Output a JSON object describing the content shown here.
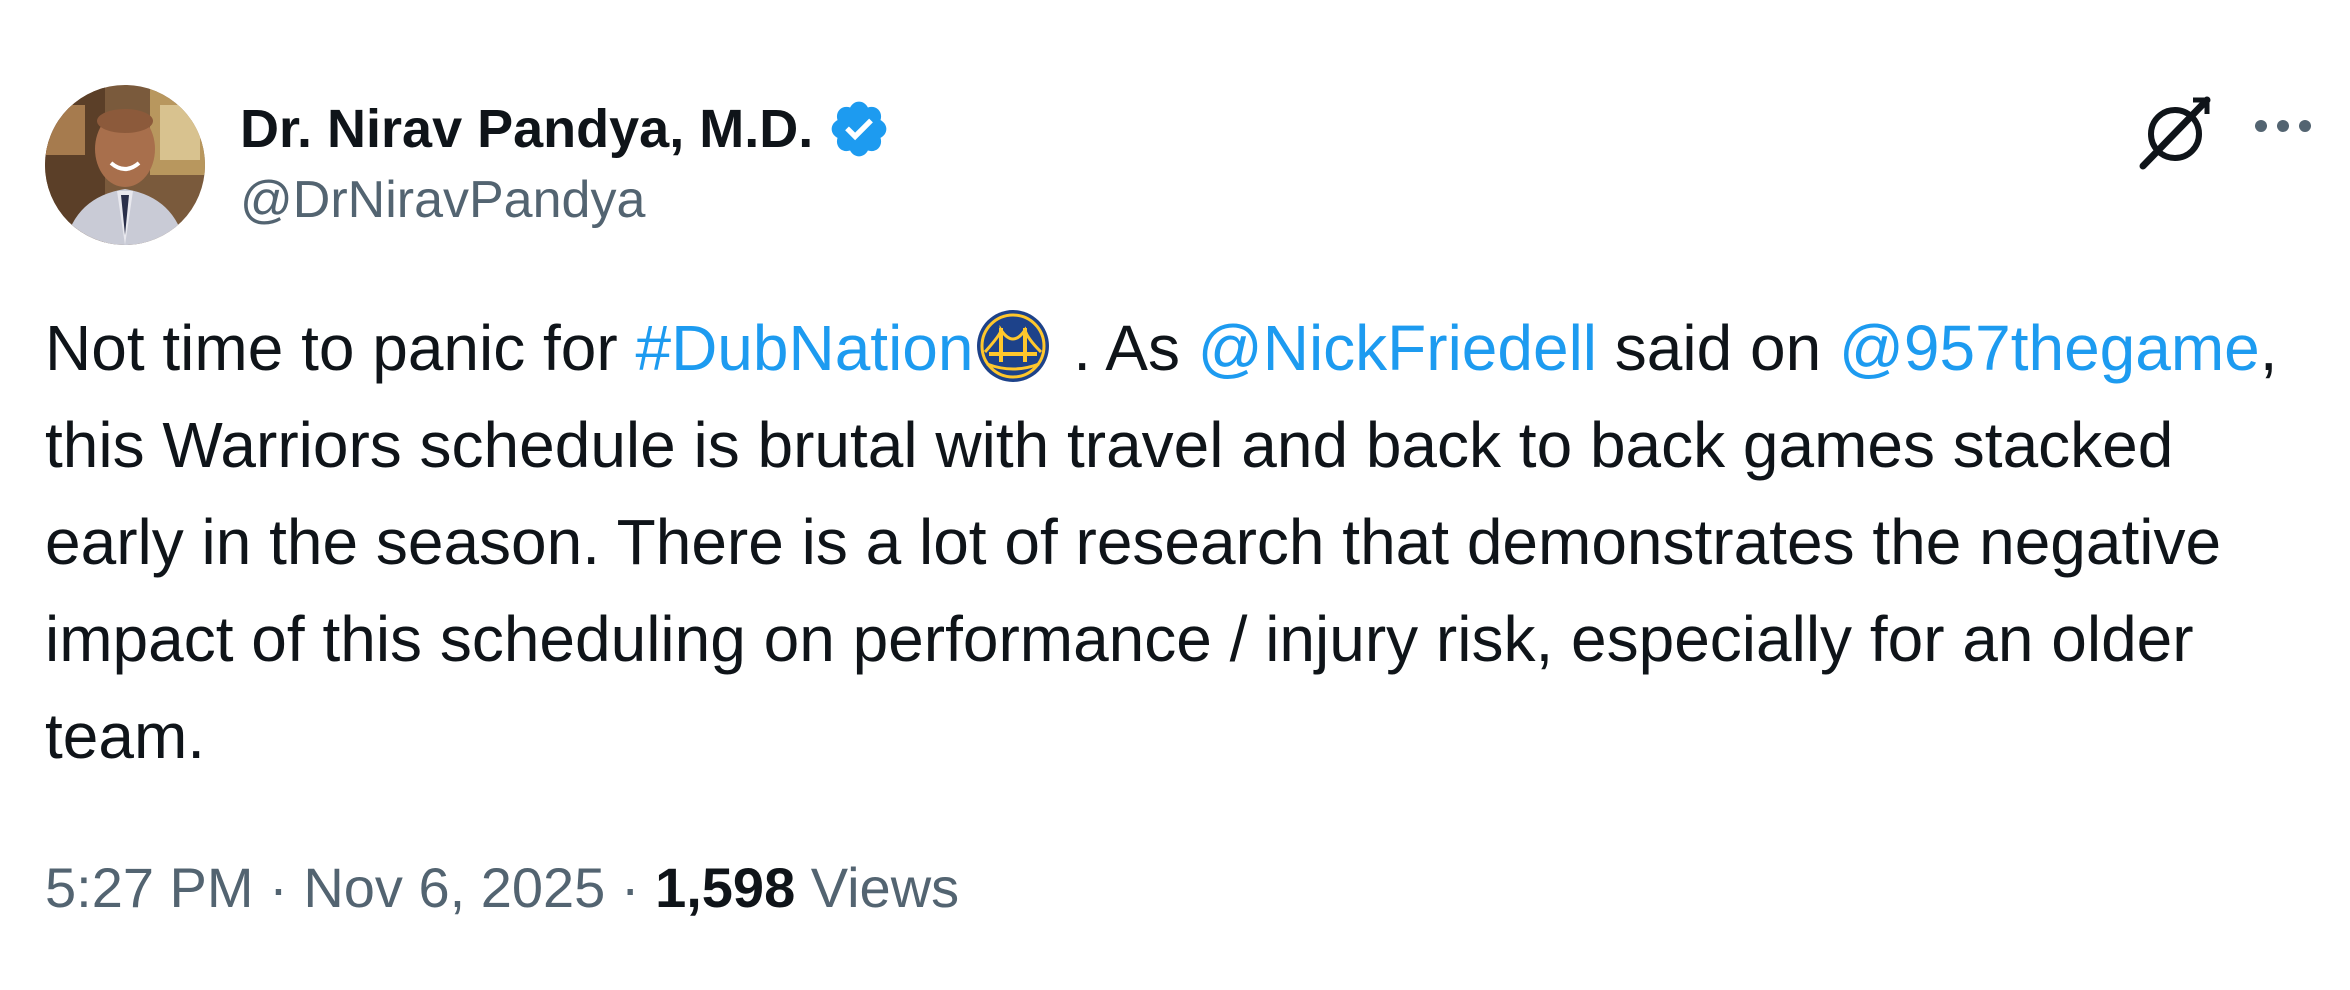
{
  "author": {
    "display_name": "Dr. Nirav Pandya, M.D.",
    "handle": "@DrNiravPandya",
    "verified": true,
    "verified_color": "#1d9bf0"
  },
  "header_actions": {
    "grok_icon": "grok-icon",
    "more_icon": "more-horizontal-icon"
  },
  "tweet": {
    "text_1": "Not time to panic for ",
    "hashtag": "#DubNation",
    "hashtag_emoji": "golden-state-warriors-logo",
    "text_2": " .  As ",
    "mention_1": "@NickFriedell",
    "text_3": " said on ",
    "mention_2": "@957thegame",
    "text_4": ", this Warriors schedule is brutal with travel and back to back games stacked early in the season. There is a lot of research that demonstrates the negative impact of this scheduling on performance / injury risk, especially for an older team.",
    "link_color": "#1d9bf0"
  },
  "meta": {
    "time": "5:27 PM",
    "separator_1": " · ",
    "date": "Nov 6, 2025",
    "separator_2": " · ",
    "views_count": "1,598",
    "views_label": " Views"
  }
}
